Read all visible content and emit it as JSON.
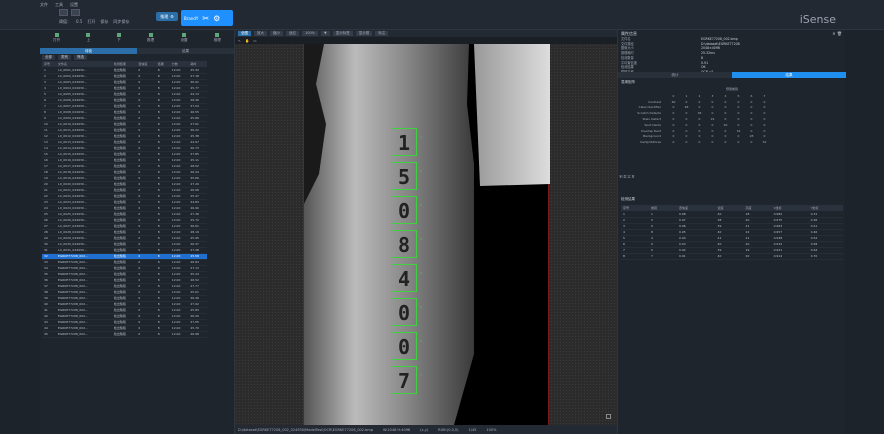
{
  "menu": [
    "文件",
    "工具",
    "设置"
  ],
  "toolbar_row2": [
    "阈值：",
    "0.5",
    "打开",
    "保存",
    "同步保存"
  ],
  "start_button": "推理",
  "brand_label": "BrandY",
  "app_logo": "iSense",
  "left": {
    "tools": [
      "打开",
      "上",
      "下",
      "推理",
      "设置",
      "推理"
    ],
    "tabs": [
      "待检",
      "结果"
    ],
    "filter": [
      "全部",
      "类别",
      "筛选"
    ],
    "columns": [
      "序号",
      "文件名",
      "检测结果",
      "置信度",
      "结果",
      "分数",
      "耗时"
    ],
    "rows": [
      [
        "1",
        "LX_0001_024930...",
        "检出缺陷",
        "0",
        "8",
        "12.00",
        "25.32"
      ],
      [
        "2",
        "LX_0002_024930...",
        "检出缺陷",
        "0",
        "8",
        "12.00",
        "27.18"
      ],
      [
        "3",
        "LX_0003_024930...",
        "检出缺陷",
        "0",
        "8",
        "12.00",
        "26.91"
      ],
      [
        "4",
        "LX_0004_024930...",
        "检出缺陷",
        "0",
        "8",
        "12.00",
        "25.77"
      ],
      [
        "5",
        "LX_0005_024930...",
        "检出缺陷",
        "0",
        "8",
        "12.00",
        "24.13"
      ],
      [
        "6",
        "LX_0006_024930...",
        "检出缺陷",
        "0",
        "8",
        "12.00",
        "28.46"
      ],
      [
        "7",
        "LX_0007_024930...",
        "检出缺陷",
        "0",
        "8",
        "12.00",
        "27.04"
      ],
      [
        "8",
        "LX_0008_024930...",
        "检出缺陷",
        "0",
        "8",
        "12.00",
        "26.55"
      ],
      [
        "9",
        "LX_0009_024930...",
        "检出缺陷",
        "0",
        "8",
        "12.00",
        "25.89"
      ],
      [
        "10",
        "LX_0010_024930...",
        "检出缺陷",
        "0",
        "8",
        "12.00",
        "27.61"
      ],
      [
        "11",
        "LX_0011_024930...",
        "检出缺陷",
        "0",
        "8",
        "12.00",
        "26.22"
      ],
      [
        "12",
        "LX_0012_024930...",
        "检出缺陷",
        "0",
        "8",
        "12.00",
        "25.38"
      ],
      [
        "13",
        "LX_0013_024930...",
        "检出缺陷",
        "0",
        "8",
        "12.00",
        "24.97"
      ],
      [
        "14",
        "LX_0014_024930...",
        "检出缺陷",
        "0",
        "8",
        "12.00",
        "26.73"
      ],
      [
        "15",
        "LX_0015_024930...",
        "检出缺陷",
        "0",
        "8",
        "12.00",
        "27.85"
      ],
      [
        "16",
        "LX_0016_024930...",
        "检出缺陷",
        "0",
        "8",
        "12.00",
        "25.11"
      ],
      [
        "17",
        "LX_0017_024930...",
        "检出缺陷",
        "0",
        "8",
        "12.00",
        "28.02"
      ],
      [
        "18",
        "LX_0018_024930...",
        "检出缺陷",
        "0",
        "8",
        "12.00",
        "26.44"
      ],
      [
        "19",
        "LX_0019_024930...",
        "检出缺陷",
        "0",
        "8",
        "12.00",
        "25.66"
      ],
      [
        "20",
        "LX_0020_024930...",
        "检出缺陷",
        "0",
        "8",
        "12.00",
        "27.29"
      ],
      [
        "21",
        "LX_0021_024930...",
        "检出缺陷",
        "0",
        "8",
        "12.00",
        "26.08"
      ],
      [
        "22",
        "LX_0022_024930...",
        "检出缺陷",
        "0",
        "8",
        "12.00",
        "25.47"
      ],
      [
        "23",
        "LX_0023_024930...",
        "检出缺陷",
        "0",
        "8",
        "12.00",
        "24.83"
      ],
      [
        "24",
        "LX_0024_024930...",
        "检出缺陷",
        "0",
        "8",
        "12.00",
        "26.90"
      ],
      [
        "25",
        "LX_0025_024930...",
        "检出缺陷",
        "0",
        "8",
        "12.00",
        "27.36"
      ],
      [
        "26",
        "LX_0026_024930...",
        "检出缺陷",
        "0",
        "8",
        "12.00",
        "25.72"
      ],
      [
        "27",
        "LX_0027_024930...",
        "检出缺陷",
        "0",
        "8",
        "12.00",
        "26.61"
      ],
      [
        "28",
        "LX_0028_024930...",
        "检出缺陷",
        "0",
        "8",
        "12.00",
        "28.19"
      ],
      [
        "29",
        "LX_0029_024930...",
        "检出缺陷",
        "0",
        "8",
        "12.00",
        "25.95"
      ],
      [
        "30",
        "LX_0030_024930...",
        "检出缺陷",
        "0",
        "8",
        "12.00",
        "26.37"
      ],
      [
        "31",
        "LX_0031_024930...",
        "检出缺陷",
        "0",
        "8",
        "12.00",
        "27.48"
      ],
      [
        "32",
        "EGRKE77208_002...",
        "检出缺陷",
        "0",
        "8",
        "12.00",
        "25.58"
      ],
      [
        "33",
        "EGRKE77208_002...",
        "检出缺陷",
        "0",
        "8",
        "12.00",
        "26.84"
      ],
      [
        "34",
        "EGRKE77208_002...",
        "检出缺陷",
        "0",
        "8",
        "12.00",
        "27.13"
      ],
      [
        "35",
        "EGRKE77208_002...",
        "检出缺陷",
        "0",
        "8",
        "12.00",
        "25.24"
      ],
      [
        "36",
        "EGRKE77208_002...",
        "检出缺陷",
        "0",
        "8",
        "12.00",
        "26.52"
      ],
      [
        "37",
        "EGRKE77208_002...",
        "检出缺陷",
        "0",
        "8",
        "12.00",
        "27.77"
      ],
      [
        "38",
        "EGRKE77208_002...",
        "检出缺陷",
        "0",
        "8",
        "12.00",
        "25.01"
      ],
      [
        "39",
        "EGRKE77208_002...",
        "检出缺陷",
        "0",
        "8",
        "12.00",
        "26.46"
      ],
      [
        "40",
        "EGRKE77208_002...",
        "检出缺陷",
        "0",
        "8",
        "12.00",
        "27.92"
      ],
      [
        "41",
        "EGRKE77208_002...",
        "检出缺陷",
        "0",
        "8",
        "12.00",
        "25.83"
      ],
      [
        "42",
        "EGRKE77208_002...",
        "检出缺陷",
        "0",
        "8",
        "12.00",
        "26.29"
      ],
      [
        "43",
        "EGRKE77208_002...",
        "检出缺陷",
        "0",
        "8",
        "12.00",
        "27.05"
      ],
      [
        "44",
        "EGRKE77208_002...",
        "检出缺陷",
        "0",
        "8",
        "12.00",
        "25.70"
      ],
      [
        "45",
        "EGRKE77208_002...",
        "检出缺陷",
        "0",
        "8",
        "12.00",
        "26.98"
      ]
    ],
    "selected_row": 31
  },
  "center": {
    "toolbar": [
      "全图",
      "放大",
      "缩小",
      "适应",
      "100%",
      "▼",
      "显示标签",
      "显示框",
      "标注"
    ],
    "status": [
      "D:\\dataset\\EGRKE77208_002_024930\\ModelTest\\OCR\\EGRKE77208_002.bmp",
      "W:2048 H:4096",
      "(x,y)",
      "RGB:(0,0,0)",
      "1/45",
      "100%"
    ],
    "detections": [
      "1",
      "5",
      "0",
      "8",
      "4",
      "0",
      "0",
      "7"
    ]
  },
  "right": {
    "title": "属性信息",
    "props": [
      [
        "文件名",
        "EGRKE77208_002.bmp"
      ],
      [
        "文件路径",
        "D:\\dataset\\EGRKE77208"
      ],
      [
        "图像大小",
        "2048×4096"
      ],
      [
        "推理耗时",
        "25.32ms"
      ],
      [
        "检测数量",
        "8"
      ],
      [
        "平均置信度",
        "0.91"
      ],
      [
        "检测结果",
        "OK"
      ],
      [
        "模型名称",
        "OCR_v2"
      ]
    ],
    "tabs": [
      "统计",
      "结果"
    ],
    "confusion_title": "混淆矩阵",
    "predicted_label": "预测类别",
    "confusion_cols": [
      "",
      "0",
      "1",
      "2",
      "3",
      "4",
      "5",
      "6",
      "7"
    ],
    "confusion_rows": [
      [
        "Contrast",
        "60",
        "0",
        "0",
        "0",
        "0",
        "0",
        "0",
        "0"
      ],
      [
        "Class Identifier",
        "0",
        "48",
        "0",
        "0",
        "0",
        "0",
        "0",
        "0"
      ],
      [
        "Scratch Defects",
        "0",
        "0",
        "36",
        "0",
        "0",
        "0",
        "0",
        "0"
      ],
      [
        "Stain Defect",
        "0",
        "0",
        "0",
        "24",
        "0",
        "0",
        "0",
        "0"
      ],
      [
        "Spot Dents",
        "0",
        "0",
        "0",
        "0",
        "40",
        "0",
        "0",
        "0"
      ],
      [
        "Overlap Dent",
        "0",
        "0",
        "0",
        "0",
        "0",
        "32",
        "0",
        "0"
      ],
      [
        "Background",
        "0",
        "0",
        "0",
        "0",
        "0",
        "0",
        "28",
        "0"
      ],
      [
        "Ins/Split/Pores",
        "0",
        "0",
        "0",
        "0",
        "0",
        "0",
        "0",
        "52"
      ]
    ],
    "true_label": "真实类别",
    "det_title": "检测结果",
    "det_columns": [
      "序号",
      "类别",
      "置信度",
      "宽度",
      "高度",
      "X坐标",
      "Y坐标"
    ],
    "det_rows": [
      [
        "1",
        "1",
        "0.98",
        "40",
        "18",
        "0.982",
        "0.31"
      ],
      [
        "2",
        "5",
        "0.97",
        "38",
        "20",
        "0.975",
        "0.36"
      ],
      [
        "3",
        "0",
        "0.96",
        "39",
        "21",
        "0.963",
        "0.41"
      ],
      [
        "4",
        "8",
        "0.95",
        "40",
        "22",
        "0.957",
        "0.46"
      ],
      [
        "5",
        "4",
        "0.94",
        "41",
        "21",
        "0.948",
        "0.52"
      ],
      [
        "6",
        "0",
        "0.93",
        "40",
        "20",
        "0.932",
        "0.58"
      ],
      [
        "7",
        "0",
        "0.92",
        "39",
        "19",
        "0.921",
        "0.64"
      ],
      [
        "8",
        "7",
        "0.91",
        "40",
        "20",
        "0.914",
        "0.70"
      ]
    ]
  }
}
